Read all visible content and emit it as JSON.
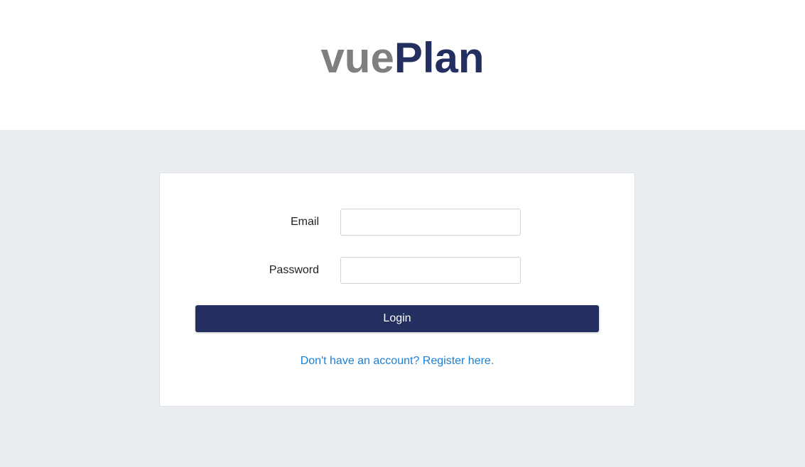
{
  "header": {
    "logo_part1": "vue",
    "logo_part2": "Plan",
    "colors": {
      "logo_part1": "#7f7f7f",
      "logo_part2": "#232f5e"
    }
  },
  "login_form": {
    "email_label": "Email",
    "email_value": "",
    "password_label": "Password",
    "password_value": "",
    "login_button_label": "Login",
    "register_link_text": "Don't have an account? Register here."
  },
  "colors": {
    "page_background": "#eaedf0",
    "primary": "#232f5e",
    "link": "#1a7fd6"
  }
}
